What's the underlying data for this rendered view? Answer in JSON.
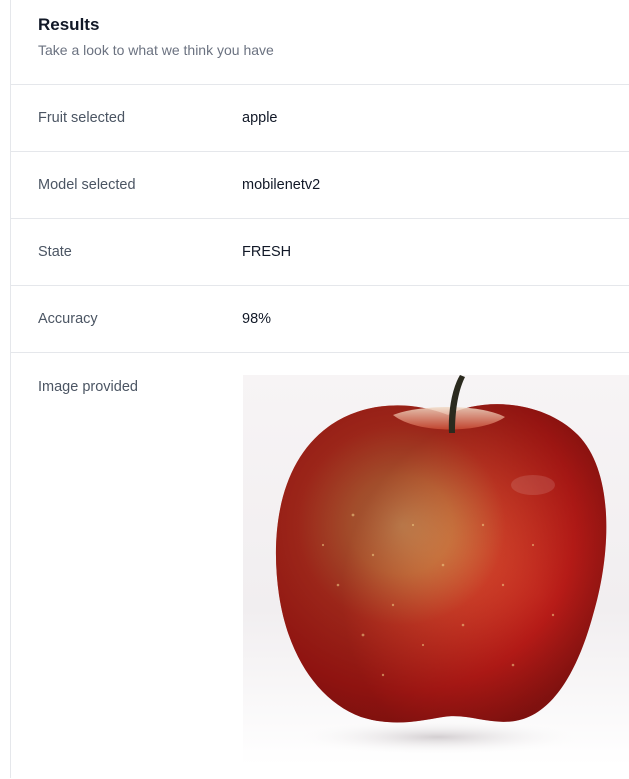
{
  "header": {
    "title": "Results",
    "subtitle": "Take a look to what we think you have"
  },
  "rows": [
    {
      "label": "Fruit selected",
      "value": "apple"
    },
    {
      "label": "Model selected",
      "value": "mobilenetv2"
    },
    {
      "label": "State",
      "value": "FRESH"
    },
    {
      "label": "Accuracy",
      "value": "98%"
    }
  ],
  "image_row": {
    "label": "Image provided",
    "image_subject": "red-apple-photo"
  },
  "colors": {
    "apple_red": "#c8231e",
    "apple_dark": "#8e1512",
    "apple_highlight": "#e8c46a",
    "stem": "#2b2a1e",
    "divider": "#e5e7eb"
  }
}
